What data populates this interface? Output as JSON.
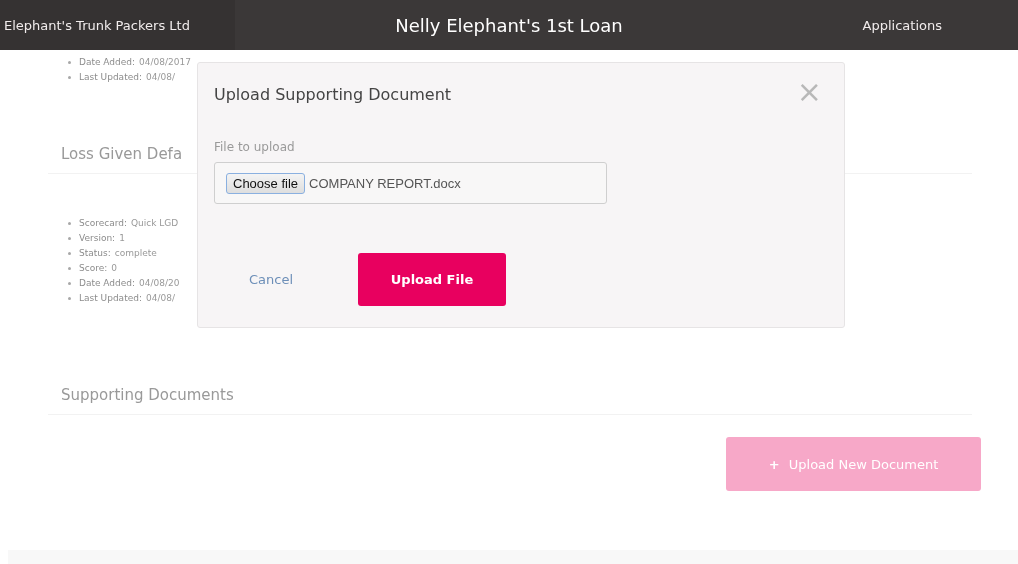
{
  "header": {
    "company": "Elephant's Trunk Packers Ltd",
    "title": "Nelly Elephant's 1st Loan",
    "nav": "Applications"
  },
  "top_details": [
    {
      "label": "Date Added:",
      "value": "04/08/2017"
    },
    {
      "label": "Last Updated:",
      "value": "04/08/"
    }
  ],
  "sections": [
    {
      "heading": "Loss Given Defa",
      "details": [
        {
          "label": "Scorecard:",
          "value": "Quick LGD"
        },
        {
          "label": "Version:",
          "value": "1"
        },
        {
          "label": "Status:",
          "value": "complete"
        },
        {
          "label": "Score:",
          "value": "0"
        },
        {
          "label": "Date Added:",
          "value": "04/08/20"
        },
        {
          "label": "Last Updated:",
          "value": "04/08/"
        }
      ]
    },
    {
      "heading": "Supporting Documents"
    }
  ],
  "upload_button": {
    "icon": "+",
    "label": "Upload New Document",
    "disabled": true
  },
  "modal": {
    "title": "Upload Supporting Document",
    "close": "×",
    "field_label": "File to upload",
    "choose_button": "Choose file",
    "file_name": "COMPANY REPORT.docx",
    "cancel": "Cancel",
    "submit": "Upload File"
  }
}
